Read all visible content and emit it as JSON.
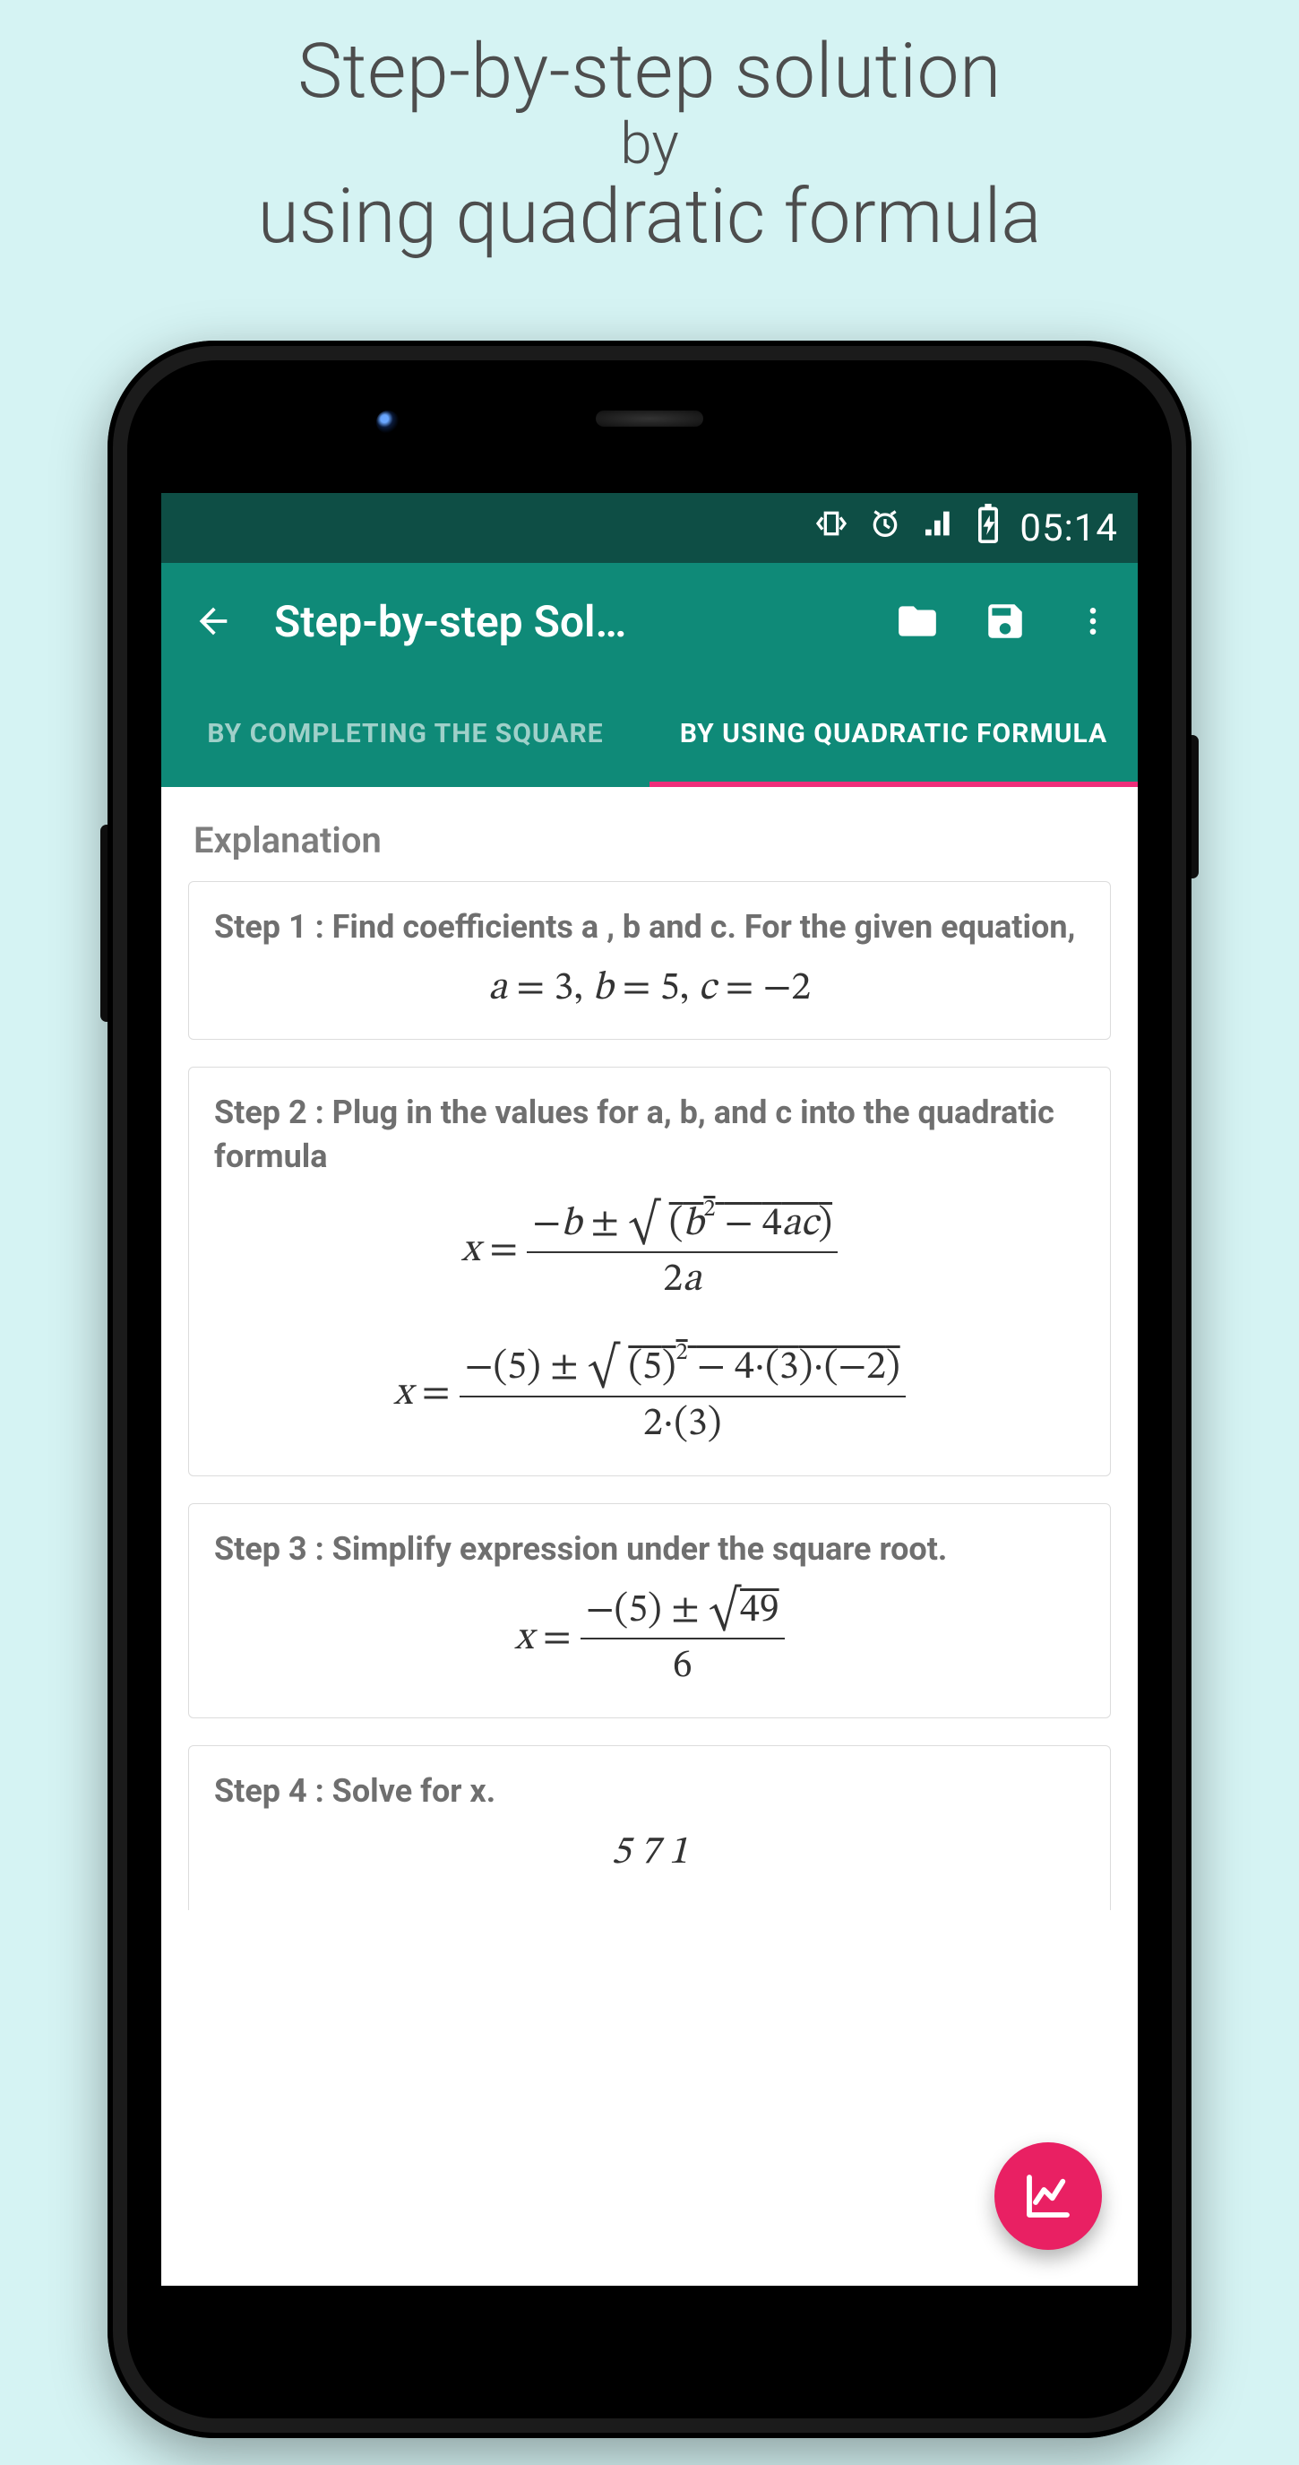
{
  "promo": {
    "line1": "Step-by-step solution",
    "line2": "by",
    "line3": "using quadratic formula"
  },
  "statusbar": {
    "time": "05:14"
  },
  "appbar": {
    "title": "Step-by-step Sol…"
  },
  "tabs": {
    "left": "BY COMPLETING THE SQUARE",
    "right": "BY USING QUADRATIC FORMULA"
  },
  "content": {
    "heading": "Explanation",
    "step1": {
      "title": "Step 1 : Find coefficients a , b and c. For the given equation,",
      "coeffs_a": "3",
      "coeffs_b": "5",
      "coeffs_c": "−2"
    },
    "step2": {
      "title": "Step 2 : Plug in the values for a, b, and c into the quadratic formula",
      "sub_b": "5",
      "sub_a": "3",
      "sub_c": "−2"
    },
    "step3": {
      "title": "Step 3 : Simplify expression under the square root.",
      "disc": "49",
      "den": "6",
      "neg_b": "−(5)"
    },
    "step4": {
      "title": "Step 4 : Solve for x.",
      "partial": "5   7   1"
    }
  }
}
